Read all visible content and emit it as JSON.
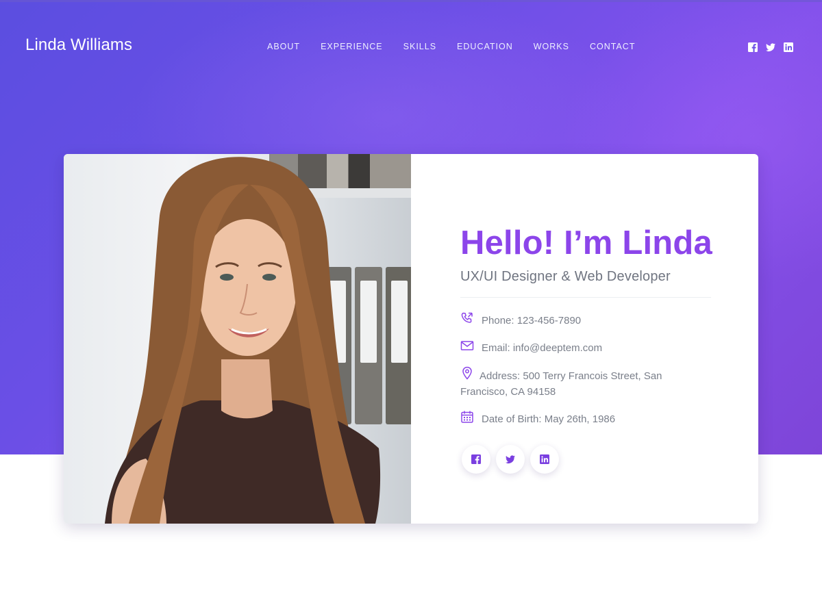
{
  "header": {
    "brand": "Linda Williams",
    "nav": [
      "ABOUT",
      "EXPERIENCE",
      "SKILLS",
      "EDUCATION",
      "WORKS",
      "CONTACT"
    ],
    "social_icons": [
      "facebook-icon",
      "twitter-icon",
      "linkedin-icon"
    ]
  },
  "profile": {
    "greeting": "Hello! I’m Linda",
    "role": "UX/UI Designer & Web Developer",
    "contacts": {
      "phone": "Phone: 123-456-7890",
      "email": "Email: info@deeptem.com",
      "address": "Address: 500 Terry Francois Street, San Francisco, CA 94158",
      "dob": "Date of Birth: May 26th, 1986"
    },
    "contact_icons": [
      "phone-icon",
      "mail-icon",
      "location-pin-icon",
      "calendar-icon"
    ],
    "social_icons": [
      "facebook-icon",
      "twitter-icon",
      "linkedin-icon"
    ]
  },
  "colors": {
    "accent": "#8c45ea",
    "hero_start": "#5b4ee0",
    "hero_end": "#7e45d8",
    "text_muted": "#7a7f8a"
  }
}
